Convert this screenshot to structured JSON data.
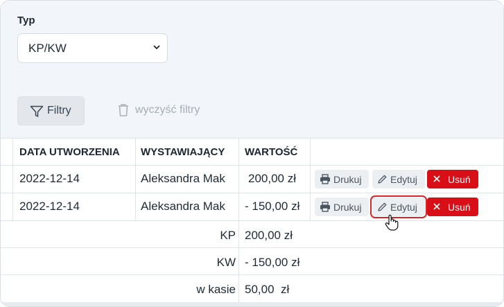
{
  "filters": {
    "type_label": "Typ",
    "type_value": "KP/KW",
    "filter_button": "Filtry",
    "clear_button": "wyczyść filtry"
  },
  "table": {
    "headers": [
      "DATA UTWORZENIA",
      "WYSTAWIAJĄCY",
      "WARTOŚĆ"
    ],
    "rows": [
      {
        "date": "2022-12-14",
        "issuer": "Aleksandra Mak",
        "value": "200,00 zł"
      },
      {
        "date": "2022-12-14",
        "issuer": "Aleksandra Mak",
        "value": "- 150,00 zł"
      }
    ],
    "actions": {
      "print": "Drukuj",
      "edit": "Edytuj",
      "delete": "Usuń"
    }
  },
  "summary": [
    {
      "label": "KP",
      "value": "200,00 zł"
    },
    {
      "label": "KW",
      "value": "- 150,00 zł"
    },
    {
      "label": "w kasie",
      "value": "50,00  zł"
    }
  ],
  "colors": {
    "panel_bg": "#f2f6fa",
    "delete_red": "#d90f17",
    "highlight_red": "#d8252a"
  }
}
